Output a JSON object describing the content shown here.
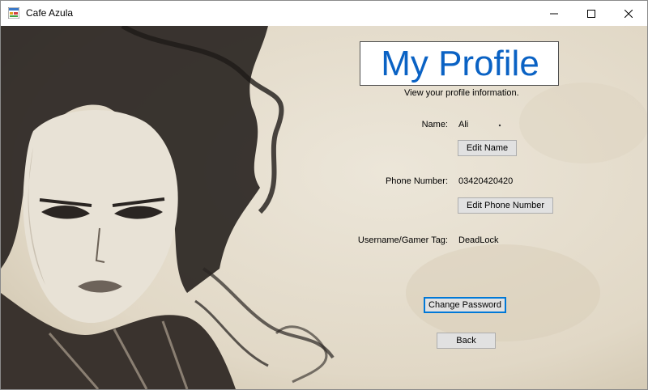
{
  "window": {
    "title": "Cafe Azula",
    "controls": {
      "minimize": "—",
      "maximize": "☐",
      "close": "✕"
    }
  },
  "profile": {
    "heading": "My Profile",
    "subtitle": "View your profile information.",
    "name_label": "Name:",
    "name_value": "Ali",
    "edit_name_label": "Edit Name",
    "phone_label": "Phone Number:",
    "phone_value": "03420420420",
    "edit_phone_label": "Edit Phone Number",
    "username_label": "Username/Gamer Tag:",
    "username_value": "DeadLock",
    "change_password_label": "Change Password",
    "back_label": "Back"
  },
  "colors": {
    "accent": "#0a62c4",
    "focus": "#0078d7",
    "background": "#e7e0d2"
  }
}
